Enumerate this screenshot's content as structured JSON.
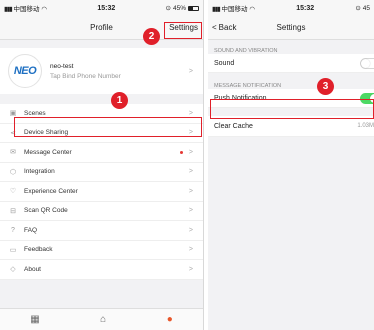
{
  "colors": {
    "accent": "#e0202a",
    "toggle_on": "#4cd964",
    "tab_active": "#e8572b"
  },
  "left": {
    "status": {
      "carrier": "中国移动",
      "time": "15:32",
      "battery": "45%"
    },
    "nav_title": "Profile",
    "settings_label": "Settings",
    "profile": {
      "avatar_text": "NEO",
      "name": "neo-test",
      "subtitle": "Tap Bind Phone Number"
    },
    "menu": [
      {
        "label": "Scenes",
        "icon": "scenes-icon"
      },
      {
        "label": "Device Sharing",
        "icon": "share-icon"
      },
      {
        "label": "Message Center",
        "icon": "message-icon"
      },
      {
        "label": "Integration",
        "icon": "integration-icon"
      },
      {
        "label": "Experience Center",
        "icon": "heart-icon"
      },
      {
        "label": "Scan QR Code",
        "icon": "qr-icon"
      },
      {
        "label": "FAQ",
        "icon": "question-icon"
      },
      {
        "label": "Feedback",
        "icon": "feedback-icon"
      },
      {
        "label": "About",
        "icon": "about-icon"
      }
    ],
    "chevron": ">"
  },
  "right": {
    "status": {
      "carrier": "中国移动",
      "time": "15:32",
      "battery": "45"
    },
    "back_label": "Back",
    "nav_title": "Settings",
    "section_sound": "SOUND AND VIBRATION",
    "sound_label": "Sound",
    "section_message": "MESSAGE NOTIFICATION",
    "push_label": "Push Notification",
    "clear_cache_label": "Clear Cache",
    "cache_size": "1.03M"
  },
  "callouts": {
    "one": "1",
    "two": "2",
    "three": "3"
  }
}
